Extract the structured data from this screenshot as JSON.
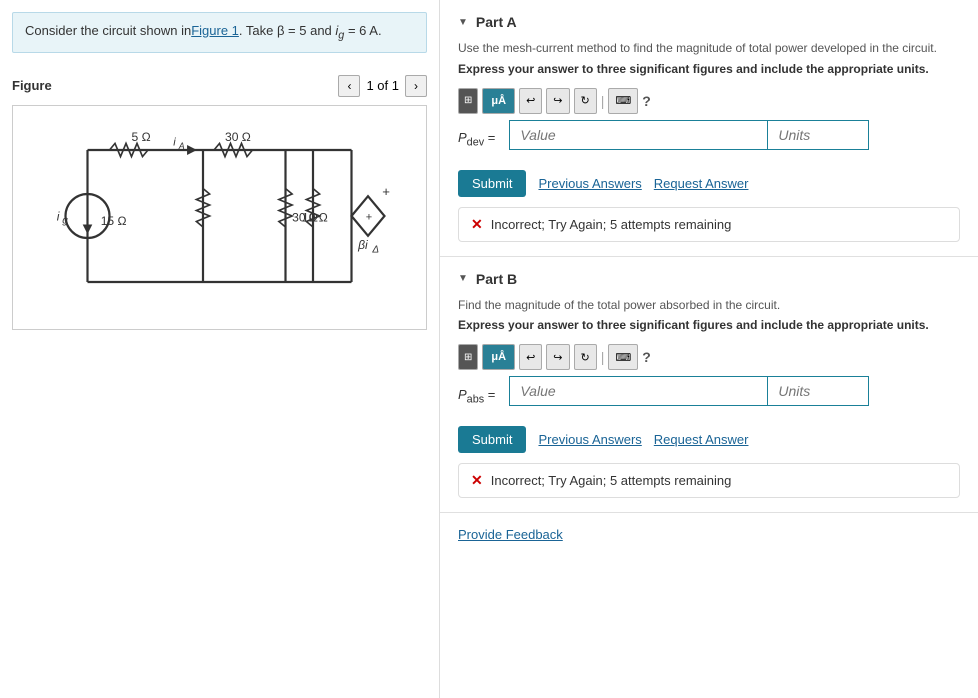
{
  "left": {
    "problem_text": "Consider the circuit shown in",
    "figure_link": "Figure 1",
    "problem_text2": ". Take β = 5 and ",
    "ig_label": "ig",
    "problem_text3": " = 6 A.",
    "figure_title": "Figure",
    "nav_text": "1 of 1"
  },
  "right": {
    "partA": {
      "title": "Part A",
      "instruction1": "Use the mesh-current method to find the magnitude of total power developed in the circuit.",
      "instruction2": "Express your answer to three significant figures and include the appropriate units.",
      "label": "Pdev =",
      "value_placeholder": "Value",
      "units_placeholder": "Units",
      "submit_label": "Submit",
      "previous_answers_label": "Previous Answers",
      "request_answer_label": "Request Answer",
      "incorrect_text": "Incorrect; Try Again; 5 attempts remaining"
    },
    "partB": {
      "title": "Part B",
      "instruction1": "Find the magnitude of the total power absorbed in the circuit.",
      "instruction2": "Express your answer to three significant figures and include the appropriate units.",
      "label": "Pabs =",
      "value_placeholder": "Value",
      "units_placeholder": "Units",
      "submit_label": "Submit",
      "previous_answers_label": "Previous Answers",
      "request_answer_label": "Request Answer",
      "incorrect_text": "Incorrect; Try Again; 5 attempts remaining"
    },
    "provide_feedback": "Provide Feedback"
  },
  "toolbar": {
    "grid_icon": "⊞",
    "ua_label": "μÅ",
    "undo_icon": "↩",
    "redo_icon": "↪",
    "refresh_icon": "↻",
    "keyboard_icon": "⌨",
    "help_icon": "?"
  }
}
